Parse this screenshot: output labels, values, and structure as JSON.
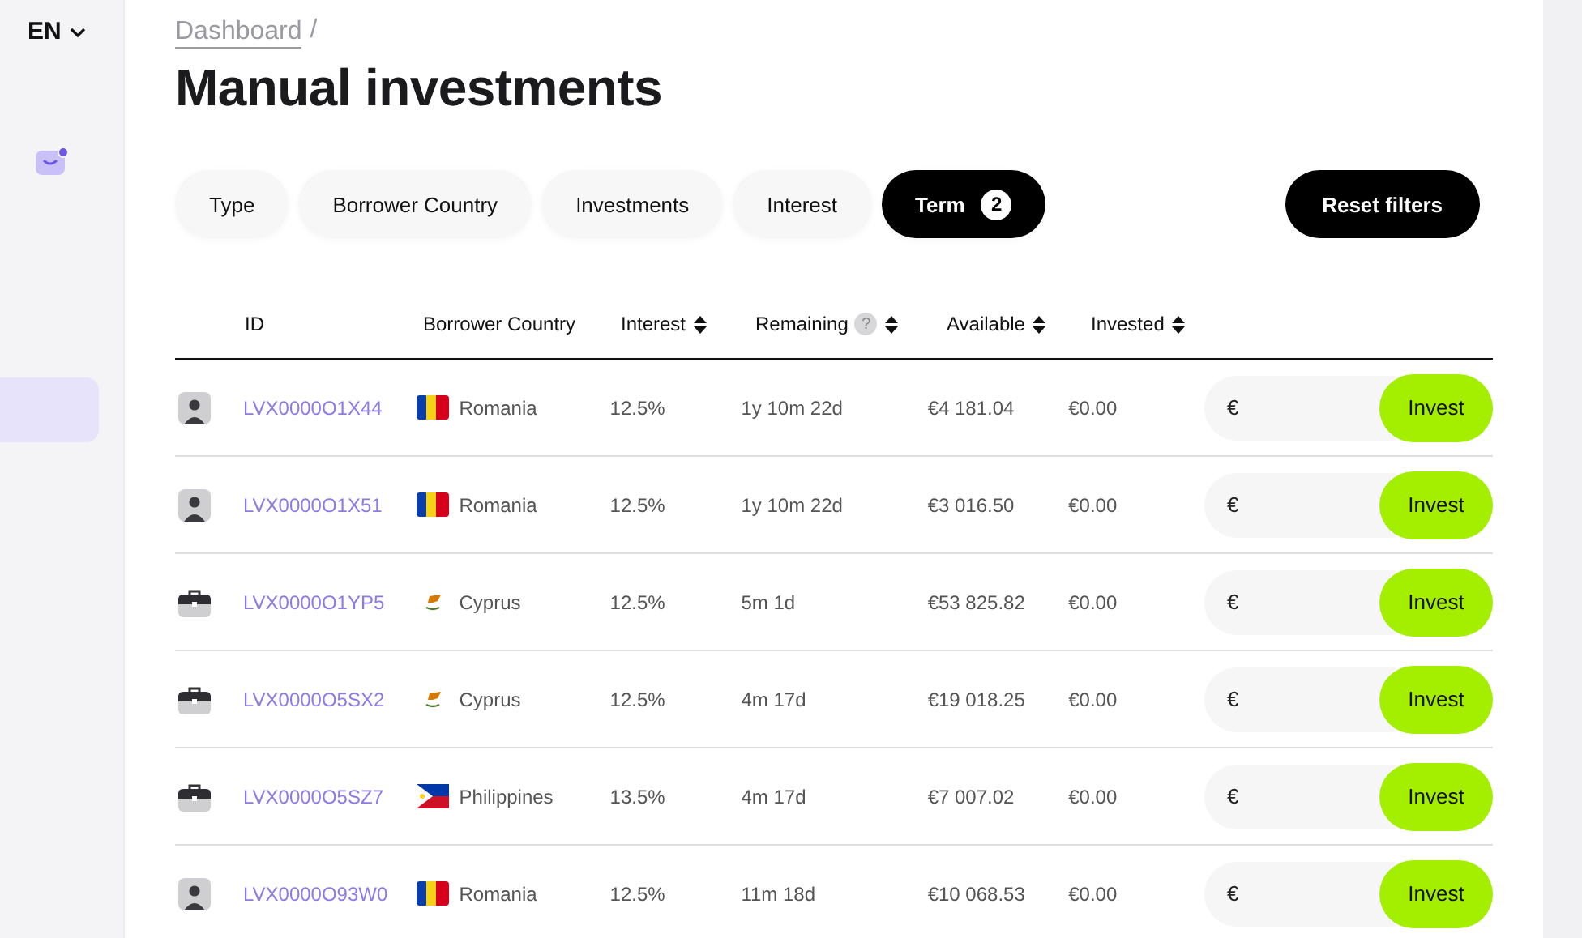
{
  "sidebar": {
    "language": "EN",
    "chat_unread": true,
    "items": [
      {
        "selected": true
      }
    ]
  },
  "breadcrumb": [
    {
      "label": "Dashboard",
      "link": true
    },
    {
      "label": "/",
      "link": false
    }
  ],
  "title": "Manual investments",
  "filters": [
    {
      "label": "Type",
      "selected": false
    },
    {
      "label": "Borrower Country",
      "selected": false
    },
    {
      "label": "Investments",
      "selected": false
    },
    {
      "label": "Interest",
      "selected": false
    },
    {
      "label": "Term",
      "selected": true,
      "count": "2"
    }
  ],
  "reset_button": "Reset filters",
  "table": {
    "columns": [
      {
        "label": "ID",
        "sortable": false,
        "help": false
      },
      {
        "label": "Borrower Country",
        "sortable": false,
        "help": false
      },
      {
        "label": "Interest",
        "sortable": true,
        "help": false
      },
      {
        "label": "Remaining",
        "sortable": true,
        "help": true,
        "help_mark": "?"
      },
      {
        "label": "Available",
        "sortable": true,
        "help": false
      },
      {
        "label": "Invested",
        "sortable": true,
        "help": false
      }
    ],
    "rows": [
      {
        "kind": "person",
        "id": "LVX0000O1X44",
        "flag": {
          "kind": "romania"
        },
        "country": "Romania",
        "interest": "12.5%",
        "remaining": "1y 10m 22d",
        "available": "€4 181.04",
        "invested": "€0.00",
        "currency": "€",
        "button": "Invest"
      },
      {
        "kind": "person",
        "id": "LVX0000O1X51",
        "flag": {
          "kind": "romania"
        },
        "country": "Romania",
        "interest": "12.5%",
        "remaining": "1y 10m 22d",
        "available": "€3 016.50",
        "invested": "€0.00",
        "currency": "€",
        "button": "Invest"
      },
      {
        "kind": "business",
        "id": "LVX0000O1YP5",
        "flag": {
          "kind": "cyprus"
        },
        "country": "Cyprus",
        "interest": "12.5%",
        "remaining": "5m 1d",
        "available": "€53 825.82",
        "invested": "€0.00",
        "currency": "€",
        "button": "Invest"
      },
      {
        "kind": "business",
        "id": "LVX0000O5SX2",
        "flag": {
          "kind": "cyprus"
        },
        "country": "Cyprus",
        "interest": "12.5%",
        "remaining": "4m 17d",
        "available": "€19 018.25",
        "invested": "€0.00",
        "currency": "€",
        "button": "Invest"
      },
      {
        "kind": "business",
        "id": "LVX0000O5SZ7",
        "flag": {
          "kind": "philippines"
        },
        "country": "Philippines",
        "interest": "13.5%",
        "remaining": "4m 17d",
        "available": "€7 007.02",
        "invested": "€0.00",
        "currency": "€",
        "button": "Invest"
      },
      {
        "kind": "person",
        "id": "LVX0000O93W0",
        "flag": {
          "kind": "romania"
        },
        "country": "Romania",
        "interest": "12.5%",
        "remaining": "11m 18d",
        "available": "€10 068.53",
        "invested": "€0.00",
        "currency": "€",
        "button": "Invest"
      }
    ]
  }
}
